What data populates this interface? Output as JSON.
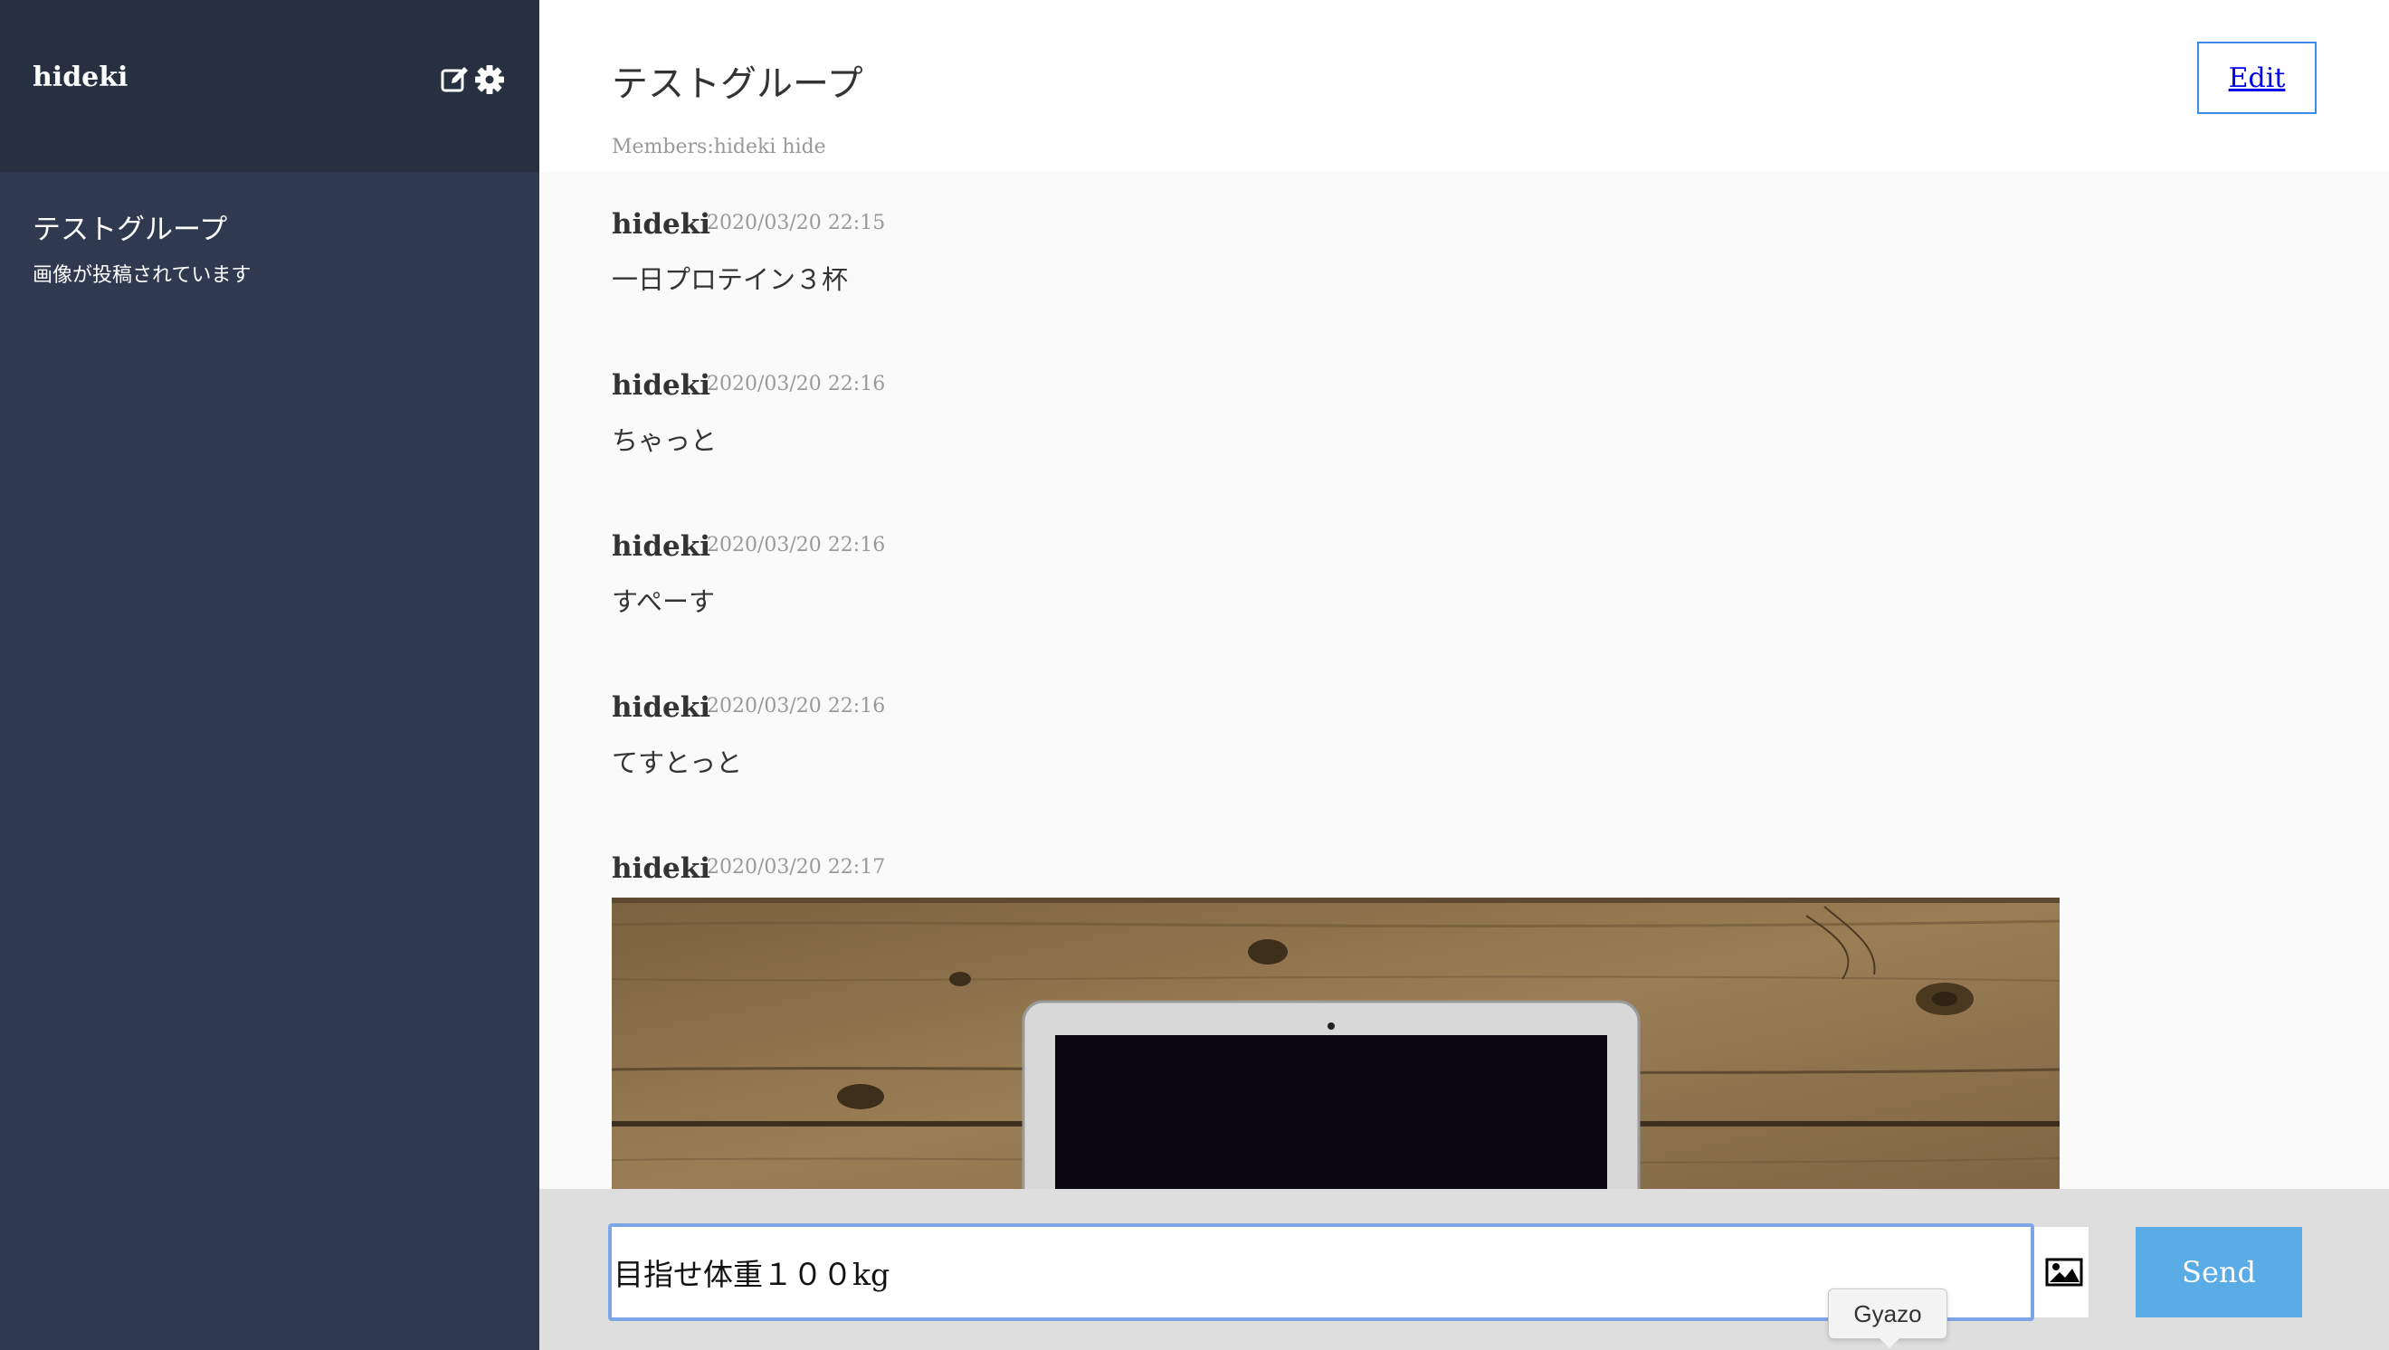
{
  "sidebar": {
    "user_name": "hideki",
    "edit_icon": "edit-icon",
    "settings_icon": "gear-icon",
    "groups": [
      {
        "name": "テストグループ",
        "last_message": "画像が投稿されています"
      }
    ]
  },
  "main": {
    "title": "テストグループ",
    "members": "Members:hideki hide",
    "edit_label": "Edit",
    "messages": [
      {
        "user": "hideki",
        "date": "2020/03/20 22:15",
        "text": "一日プロテイン３杯"
      },
      {
        "user": "hideki",
        "date": "2020/03/20 22:16",
        "text": "ちゃっと"
      },
      {
        "user": "hideki",
        "date": "2020/03/20 22:16",
        "text": "すぺーす"
      },
      {
        "user": "hideki",
        "date": "2020/03/20 22:16",
        "text": "てすとっと"
      },
      {
        "user": "hideki",
        "date": "2020/03/20 22:17",
        "text": ""
      }
    ]
  },
  "form": {
    "input_value": "目指せ体重１００kg",
    "image_icon": "image-icon",
    "send_label": "Send",
    "tooltip": "Gyazo"
  },
  "colors": {
    "sidebar_bg": "#2f3a50",
    "sidebar_header_bg": "#263041",
    "send_button": "#5aace6",
    "edit_border": "#3b8be8"
  }
}
